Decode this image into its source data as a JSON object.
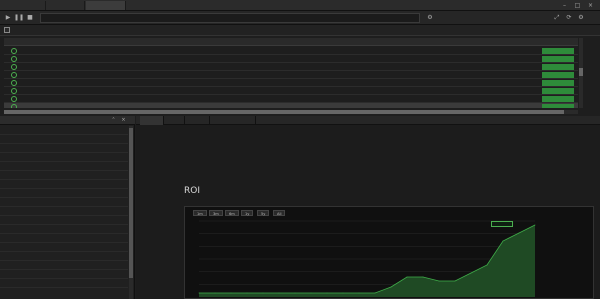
{
  "window": {
    "tabs": [
      {
        "label": "",
        "active": false
      },
      {
        "label": "",
        "active": false
      },
      {
        "label": "",
        "active": true
      }
    ],
    "window_buttons": [
      "minimize-icon",
      "maximize-icon",
      "close-icon"
    ]
  },
  "filterbar": {
    "checkbox_label": "",
    "items": [
      "",
      "",
      ""
    ]
  },
  "table": {
    "columns": [
      "",
      "",
      "",
      "",
      "",
      "",
      "",
      "",
      "",
      "",
      "",
      "",
      "",
      "",
      "",
      ""
    ],
    "rows": [
      {
        "cells": [
          "",
          "",
          "",
          "",
          "",
          "",
          "",
          "",
          "",
          "",
          "",
          "",
          "",
          "",
          ""
        ],
        "action": "",
        "selected": false
      },
      {
        "cells": [
          "",
          "",
          "",
          "",
          "",
          "",
          "",
          "",
          "",
          "",
          "",
          "",
          "",
          "",
          ""
        ],
        "action": "",
        "selected": false
      },
      {
        "cells": [
          "",
          "",
          "",
          "",
          "",
          "",
          "",
          "",
          "",
          "",
          "",
          "",
          "",
          "",
          ""
        ],
        "action": "",
        "selected": false
      },
      {
        "cells": [
          "",
          "",
          "",
          "",
          "",
          "",
          "",
          "",
          "",
          "",
          "",
          "",
          "",
          "",
          ""
        ],
        "action": "",
        "selected": false
      },
      {
        "cells": [
          "",
          "",
          "",
          "",
          "",
          "",
          "",
          "",
          "",
          "",
          "",
          "",
          "",
          "",
          ""
        ],
        "action": "",
        "selected": false
      },
      {
        "cells": [
          "",
          "",
          "",
          "",
          "",
          "",
          "",
          "",
          "",
          "",
          "",
          "",
          "",
          "",
          ""
        ],
        "action": "",
        "selected": false
      },
      {
        "cells": [
          "",
          "",
          "",
          "",
          "",
          "",
          "",
          "",
          "",
          "",
          "",
          "",
          "",
          "",
          ""
        ],
        "action": "",
        "selected": false
      },
      {
        "cells": [
          "",
          "",
          "",
          "",
          "",
          "",
          "",
          "",
          "",
          "",
          "",
          "",
          "",
          "",
          ""
        ],
        "action": "",
        "selected": true
      }
    ]
  },
  "params_panel": {
    "title": "",
    "rows": [
      {
        "name": "",
        "value": ""
      },
      {
        "name": "",
        "value": ""
      },
      {
        "name": "",
        "value": ""
      },
      {
        "name": "",
        "value": ""
      },
      {
        "name": "",
        "value": ""
      },
      {
        "name": "",
        "value": ""
      },
      {
        "name": "",
        "value": ""
      },
      {
        "name": "",
        "value": ""
      },
      {
        "name": "",
        "value": ""
      },
      {
        "name": "",
        "value": ""
      },
      {
        "name": "",
        "value": ""
      },
      {
        "name": "",
        "value": ""
      },
      {
        "name": "",
        "value": ""
      },
      {
        "name": "",
        "value": ""
      },
      {
        "name": "",
        "value": ""
      },
      {
        "name": "",
        "value": ""
      },
      {
        "name": "",
        "value": ""
      },
      {
        "name": "",
        "value": ""
      }
    ]
  },
  "result_tabs": [
    {
      "label": "",
      "active": true
    },
    {
      "label": "",
      "active": false
    },
    {
      "label": "",
      "active": false
    },
    {
      "label": "",
      "active": false
    }
  ],
  "summary": {
    "header_left": "",
    "header_right": "",
    "left": [
      {
        "label": "",
        "value": ""
      },
      {
        "label": "",
        "value": ""
      },
      {
        "label": "",
        "value": ""
      },
      {
        "label": "",
        "value": ""
      }
    ],
    "middle": [
      {
        "label": "",
        "value": ""
      },
      {
        "label": "",
        "value": ""
      },
      {
        "label": "",
        "value": ""
      },
      {
        "label": "",
        "value": ""
      }
    ],
    "right": [
      {
        "label": "",
        "value": ""
      },
      {
        "label": "",
        "value": ""
      },
      {
        "label": "",
        "value": ""
      }
    ],
    "right2": [
      {
        "label": "",
        "value": ""
      },
      {
        "label": "",
        "value": ""
      },
      {
        "label": "",
        "value": ""
      }
    ]
  },
  "roi": {
    "title": "ROI",
    "zoom_buttons": [
      "1m",
      "3m",
      "6m",
      "1y",
      "5y",
      "All"
    ],
    "legend": "",
    "tooltip": "",
    "y_ticks": [
      "",
      "",
      "",
      "",
      "",
      ""
    ]
  },
  "chart_data": {
    "type": "area",
    "title": "ROI",
    "x": [],
    "series": [
      {
        "values": [
          0,
          0,
          0,
          0,
          0,
          0,
          0,
          0,
          0,
          0,
          0,
          0,
          3,
          8,
          8,
          6,
          6,
          10,
          14,
          26,
          30,
          34
        ]
      }
    ],
    "ylim": [
      -2,
      36
    ],
    "grid": true,
    "colors": {
      "line": "#3fae49",
      "fill": "#1f4a24"
    }
  },
  "colors": {
    "accent_green": "#2e8b3a",
    "background": "#1e1e1e"
  }
}
